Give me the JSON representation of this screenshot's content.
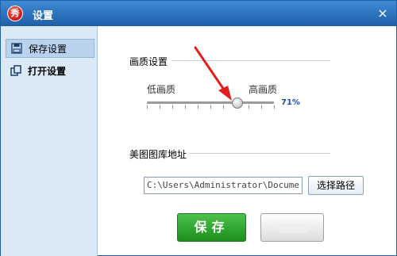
{
  "window": {
    "title": "设置",
    "app_icon_text": "秀",
    "close_glyph": "×"
  },
  "sidebar": {
    "items": [
      {
        "label": "保存设置",
        "icon": "save-icon",
        "active": true
      },
      {
        "label": "打开设置",
        "icon": "open-windows-icon",
        "active": false
      }
    ]
  },
  "quality": {
    "title": "画质设置",
    "low_label": "低画质",
    "high_label": "高画质",
    "value": 0.71,
    "value_text": "71%"
  },
  "library": {
    "title": "美图图库地址",
    "path_value": "C:\\Users\\Administrator\\Docume",
    "browse_label": "选择路径"
  },
  "footer": {
    "save_label": "保存"
  },
  "colors": {
    "accent": "#1e5fa8",
    "save_green": "#1d8e1d",
    "arrow_red": "#e0201e"
  }
}
